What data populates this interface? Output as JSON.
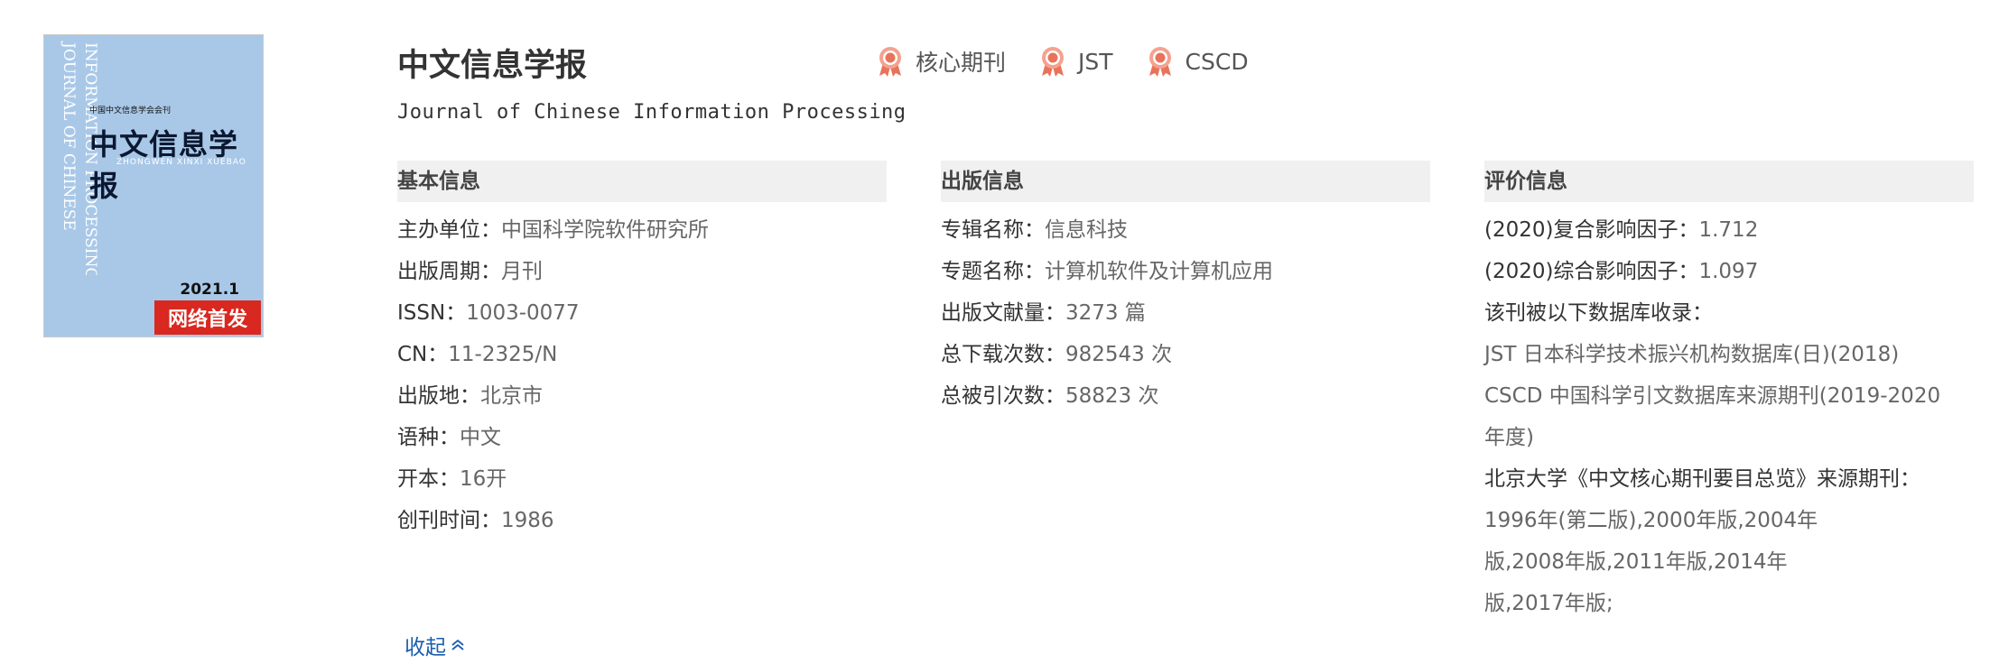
{
  "cover": {
    "vertical_text_1": "JOURNAL OF CHINESE",
    "vertical_text_2": "INFORMATION PROCESSING",
    "society": "中国中文信息学会会刊",
    "name": "中文信息学报",
    "pinyin": "ZHONGWEN XINXI XUEBAO",
    "date": "2021.1",
    "badge": "网络首发"
  },
  "header": {
    "title": "中文信息学报",
    "subtitle": "Journal of Chinese Information Processing",
    "tags": [
      "核心期刊",
      "JST",
      "CSCD"
    ],
    "tag_icon": "award-ribbon-icon",
    "tag_icon_color": "#e8735a"
  },
  "basic": {
    "heading": "基本信息",
    "rows": [
      {
        "label": "主办单位：",
        "value": "中国科学院软件研究所"
      },
      {
        "label": "出版周期：",
        "value": "月刊"
      },
      {
        "label": "ISSN：",
        "value": "1003-0077"
      },
      {
        "label": "CN：",
        "value": "11-2325/N"
      },
      {
        "label": "出版地：",
        "value": "北京市"
      },
      {
        "label": "语种：",
        "value": "中文"
      },
      {
        "label": "开本：",
        "value": "16开"
      },
      {
        "label": "创刊时间：",
        "value": "1986"
      }
    ]
  },
  "publication": {
    "heading": "出版信息",
    "rows": [
      {
        "label": "专辑名称：",
        "value": "信息科技"
      },
      {
        "label": "专题名称：",
        "value": "计算机软件及计算机应用"
      },
      {
        "label": "出版文献量：",
        "value": "3273 篇"
      },
      {
        "label": "总下载次数：",
        "value": "982543 次"
      },
      {
        "label": "总被引次数：",
        "value": "58823 次"
      }
    ]
  },
  "evaluation": {
    "heading": "评价信息",
    "if_composite_label": "(2020)复合影响因子：",
    "if_composite_value": "1.712",
    "if_overall_label": "(2020)综合影响因子：",
    "if_overall_value": "1.097",
    "db_label": "该刊被以下数据库收录：",
    "db_jst": "JST 日本科学技术振兴机构数据库(日)(2018)",
    "db_cscd_1": "CSCD 中国科学引文数据库来源期刊(2019-2020",
    "db_cscd_2": "年度)",
    "pku_label": "北京大学《中文核心期刊要目总览》来源期刊：",
    "pku_1": "1996年(第二版),2000年版,2004年",
    "pku_2": "版,2008年版,2011年版,2014年",
    "pku_3": "版,2017年版;"
  },
  "collapse_label": "收起",
  "colors": {
    "link": "#1a5dad",
    "badge": "#d9281f",
    "cover": "#a9c8e8",
    "section_bg": "#f0f0f0"
  }
}
